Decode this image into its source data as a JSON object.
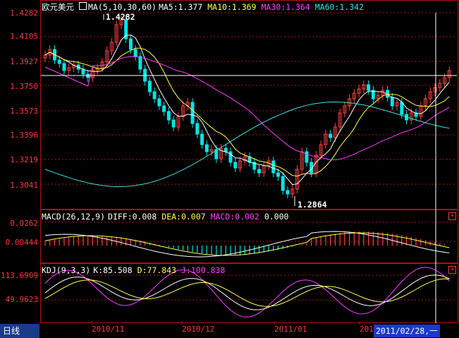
{
  "main": {
    "symbol": "欧元美元",
    "ma_label": "MA(5,10,30,60)",
    "ma5": "MA5:1.377",
    "ma10": "MA10:1.369",
    "ma30": "MA30:1.364",
    "ma60": "MA60:1.342",
    "y_ticks": [
      "1.4282",
      "1.4105",
      "1.3927",
      "1.3750",
      "1.3573",
      "1.3396",
      "1.3219",
      "1.3041"
    ],
    "high_label": "1.4282",
    "low_label": "1.2864"
  },
  "macd": {
    "label": "MACD(26,12,9)",
    "diff": "DIFF:0.008",
    "dea": "DEA:0.007",
    "macd": "MACD:0.002",
    "extra": "0.000",
    "y_ticks": [
      "0.0262",
      "0.00444"
    ]
  },
  "kdj": {
    "label": "KDJ(9,3,3)",
    "k": "K:85.508",
    "d": "D:77.843",
    "j": "J:100.838",
    "y_ticks": [
      "113.6909",
      "49.9623"
    ]
  },
  "footer": {
    "period": "日线",
    "months": [
      "2010/11",
      "2010/12",
      "2011/01",
      "201"
    ],
    "cursor_date": "2011/02/28,一"
  },
  "colors": {
    "up": "#ff4040",
    "down": "#00e5e5",
    "ma5": "#ffffff",
    "ma10": "#ffff55",
    "ma30": "#ff40ff",
    "ma60": "#40e0e0",
    "grid": "#b01010"
  }
}
